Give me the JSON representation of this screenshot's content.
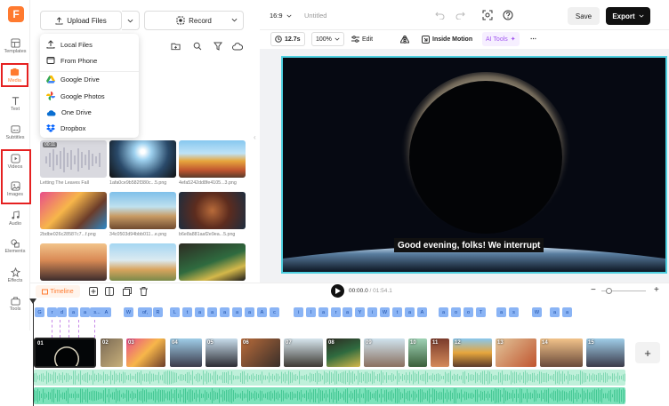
{
  "sidebar": {
    "logo": "F",
    "items": [
      {
        "label": "Templates",
        "icon": "templates-icon"
      },
      {
        "label": "Media",
        "icon": "media-icon",
        "active": true
      },
      {
        "label": "Text",
        "icon": "text-icon"
      },
      {
        "label": "Subtitles",
        "icon": "subtitles-icon"
      },
      {
        "label": "Videos",
        "icon": "videos-icon"
      },
      {
        "label": "Images",
        "icon": "images-icon"
      },
      {
        "label": "Audio",
        "icon": "audio-icon"
      },
      {
        "label": "Elements",
        "icon": "elements-icon"
      },
      {
        "label": "Effects",
        "icon": "effects-icon"
      },
      {
        "label": "Tools",
        "icon": "tools-icon"
      }
    ]
  },
  "media_panel": {
    "upload_label": "Upload Files",
    "record_label": "Record",
    "upload_menu": [
      {
        "label": "Local Files",
        "icon": "upload-icon"
      },
      {
        "label": "From Phone",
        "icon": "phone-icon"
      },
      {
        "label": "Google Drive",
        "icon": "google-drive-icon"
      },
      {
        "label": "Google Photos",
        "icon": "google-photos-icon"
      },
      {
        "label": "One Drive",
        "icon": "onedrive-icon"
      },
      {
        "label": "Dropbox",
        "icon": "dropbox-icon"
      }
    ],
    "duration_badge": "00:11",
    "captions": [
      "Letting The Leaves Fall",
      "1afa0ce9b582f380c...5.png",
      "4efa5242dd8fe4105...3.png",
      "2bdbe026c28587c7...f.png",
      "34c0503d94bbb011...e.png",
      "b6e8a881aaf2e9ea...5.png"
    ]
  },
  "topbar": {
    "aspect_ratio": "16:9",
    "project_title": "Untitled",
    "save_label": "Save",
    "export_label": "Export"
  },
  "editor_toolbar": {
    "duration": "12.7s",
    "zoom": "100%",
    "edit_label": "Edit",
    "inside_motion_label": "Inside Motion",
    "ai_tools_label": "AI Tools"
  },
  "canvas": {
    "subtitle_text": "Good evening, folks! We interrupt"
  },
  "timeline": {
    "tab_label": "Timeline",
    "current_time": "00:00.0",
    "separator": "/",
    "total_time": "01:54.1",
    "word_chips": [
      "G",
      "r",
      "d",
      "a",
      "a",
      "s...",
      "A",
      "W",
      "of,",
      "R",
      "L",
      "t",
      "a",
      "a",
      "a",
      "a",
      "a",
      "A",
      "c",
      "i",
      "I",
      "a",
      "r",
      "a",
      "Y",
      "i",
      "W",
      "t",
      "a",
      "A",
      "a",
      "o",
      "o",
      "T",
      "a",
      "s",
      "W",
      "a",
      "a"
    ],
    "clip_numbers": [
      "01",
      "02",
      "03",
      "04",
      "05",
      "06",
      "07",
      "08",
      "09",
      "10",
      "11",
      "12",
      "13",
      "14",
      "15"
    ]
  },
  "colors": {
    "accent": "#ff7a2f",
    "export_bg": "#111111",
    "canvas_outline": "#4fd0e0",
    "word_chip": "#8ab4f5",
    "audio_light": "#bff0da",
    "audio_dark": "#7de2bb",
    "highlight_box": "#e52020"
  }
}
